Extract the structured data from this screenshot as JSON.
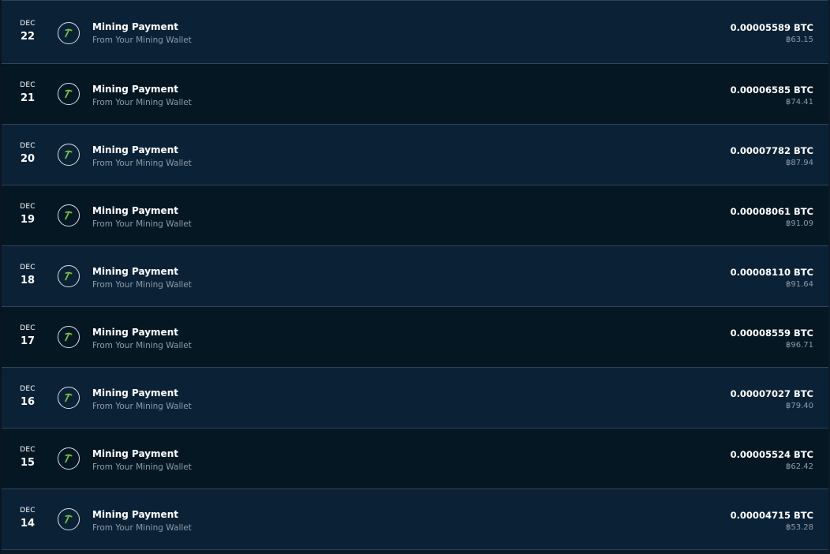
{
  "transactions": [
    {
      "month": "DEC",
      "day": "22",
      "title": "Mining Payment",
      "subtitle": "From Your Mining Wallet",
      "amount": "0.00005589 BTC",
      "fiat": "฿63.15",
      "icon": "pickaxe-icon"
    },
    {
      "month": "DEC",
      "day": "21",
      "title": "Mining Payment",
      "subtitle": "From Your Mining Wallet",
      "amount": "0.00006585 BTC",
      "fiat": "฿74.41",
      "icon": "pickaxe-icon"
    },
    {
      "month": "DEC",
      "day": "20",
      "title": "Mining Payment",
      "subtitle": "From Your Mining Wallet",
      "amount": "0.00007782 BTC",
      "fiat": "฿87.94",
      "icon": "pickaxe-icon"
    },
    {
      "month": "DEC",
      "day": "19",
      "title": "Mining Payment",
      "subtitle": "From Your Mining Wallet",
      "amount": "0.00008061 BTC",
      "fiat": "฿91.09",
      "icon": "pickaxe-icon"
    },
    {
      "month": "DEC",
      "day": "18",
      "title": "Mining Payment",
      "subtitle": "From Your Mining Wallet",
      "amount": "0.00008110 BTC",
      "fiat": "฿91.64",
      "icon": "pickaxe-icon"
    },
    {
      "month": "DEC",
      "day": "17",
      "title": "Mining Payment",
      "subtitle": "From Your Mining Wallet",
      "amount": "0.00008559 BTC",
      "fiat": "฿96.71",
      "icon": "pickaxe-icon"
    },
    {
      "month": "DEC",
      "day": "16",
      "title": "Mining Payment",
      "subtitle": "From Your Mining Wallet",
      "amount": "0.00007027 BTC",
      "fiat": "฿79.40",
      "icon": "pickaxe-icon"
    },
    {
      "month": "DEC",
      "day": "15",
      "title": "Mining Payment",
      "subtitle": "From Your Mining Wallet",
      "amount": "0.00005524 BTC",
      "fiat": "฿62.42",
      "icon": "pickaxe-icon"
    },
    {
      "month": "DEC",
      "day": "14",
      "title": "Mining Payment",
      "subtitle": "From Your Mining Wallet",
      "amount": "0.00004715 BTC",
      "fiat": "฿53.28",
      "icon": "pickaxe-icon"
    }
  ],
  "colors": {
    "row_light": "#0b2236",
    "row_dark": "#061724",
    "divider": "#2c4559",
    "icon_green": "#7bc043",
    "text_primary": "#ffffff",
    "text_secondary": "#8c9baa"
  }
}
